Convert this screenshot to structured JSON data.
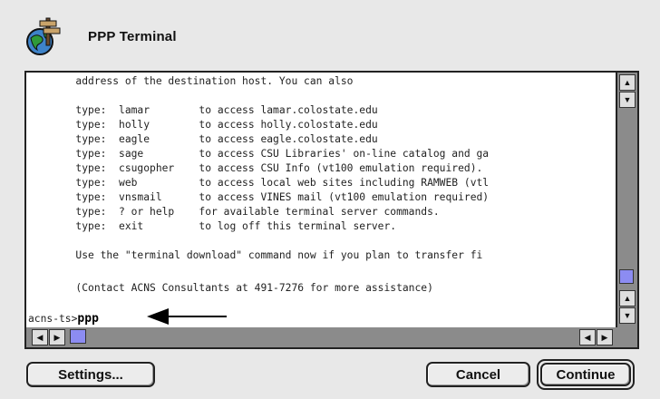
{
  "window": {
    "title": "PPP Terminal"
  },
  "terminal": {
    "lines": [
      "        address of the destination host. You can also",
      "",
      "        type:  lamar        to access lamar.colostate.edu",
      "        type:  holly        to access holly.colostate.edu",
      "        type:  eagle        to access eagle.colostate.edu",
      "        type:  sage         to access CSU Libraries' on-line catalog and ga",
      "        type:  csugopher    to access CSU Info (vt100 emulation required).",
      "        type:  web          to access local web sites including RAMWEB (vtl",
      "        type:  vnsmail      to access VINES mail (vt100 emulation required)",
      "        type:  ? or help    for available terminal server commands.",
      "        type:  exit         to log off this terminal server.",
      "",
      "        Use the \"terminal download\" command now if you plan to transfer fi",
      "",
      "        (Contact ACNS Consultants at 491-7276 for more assistance)"
    ],
    "prompt": "acns-ts>",
    "input": "ppp"
  },
  "buttons": {
    "settings": "Settings...",
    "cancel": "Cancel",
    "continue": "Continue"
  },
  "colors": {
    "background": "#e8e8e8",
    "scroll_track": "#8b8b8b",
    "scroll_thumb": "#8c8cf2"
  },
  "icons": {
    "app": "ppp-signpost-globe-icon",
    "arrow": "pointer-arrow-icon"
  }
}
